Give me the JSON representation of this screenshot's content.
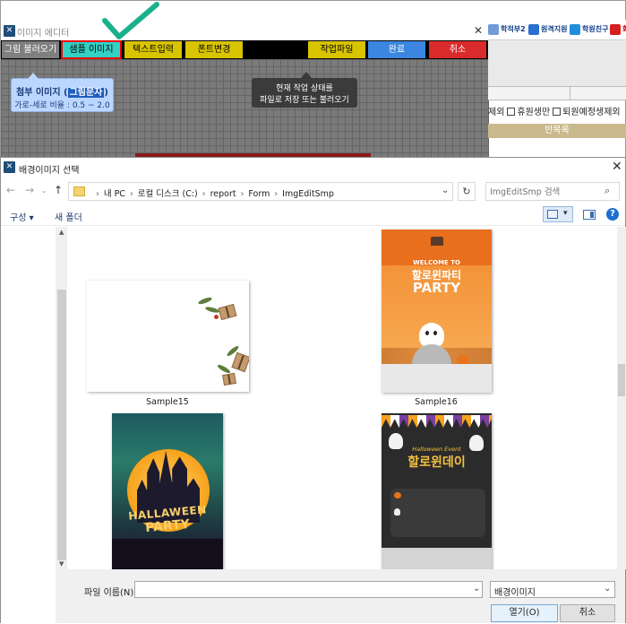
{
  "editor": {
    "title": "이미지 에디터",
    "toolbar": {
      "load_image": "그림 불러오기",
      "sample_image": "샘플 이미지",
      "text_input": "텍스트입력",
      "font_change": "폰트변경",
      "work_file": "작업파일",
      "done": "완료",
      "cancel": "취소"
    },
    "tip_left": {
      "line1_prefix": "첨부 이미지 (",
      "line1_highlight": "그림문자",
      "line1_suffix": ")",
      "line2": "가로-세로 비율 : 0.5 ~ 2.0"
    },
    "tip_right": {
      "line1": "현재 작업 상태를",
      "line2": "파일로 저장 또는 불러오기"
    }
  },
  "background_app": {
    "buttons": [
      "학적부2",
      "원격지원",
      "학원친구",
      "화"
    ],
    "checks": [
      "제외",
      "휴원생만",
      "퇴원예정생제외"
    ],
    "header": "반목록"
  },
  "dialog": {
    "title": "배경이미지 선택",
    "path": [
      "내 PC",
      "로컬 디스크 (C:)",
      "report",
      "Form",
      "ImgEditSmp"
    ],
    "search_placeholder": "ImgEditSmp 검색",
    "organize": "구성 ▾",
    "new_folder": "새 폴더",
    "help": "?",
    "files": [
      {
        "name": "Sample15"
      },
      {
        "name": "Sample16",
        "text1": "WELCOME TO",
        "text2": "할로윈파티",
        "text3": "PARTY"
      },
      {
        "name": "",
        "text1": "HALLAWEEN",
        "text2": "PARTY"
      },
      {
        "name": "",
        "text1": "Halloween Event",
        "text2": "할로윈데이"
      }
    ],
    "filename_label": "파일 이름(N):",
    "filename_value": "",
    "filetype": "배경이미지",
    "open_button": "열기(O)",
    "cancel_button": "취소"
  }
}
